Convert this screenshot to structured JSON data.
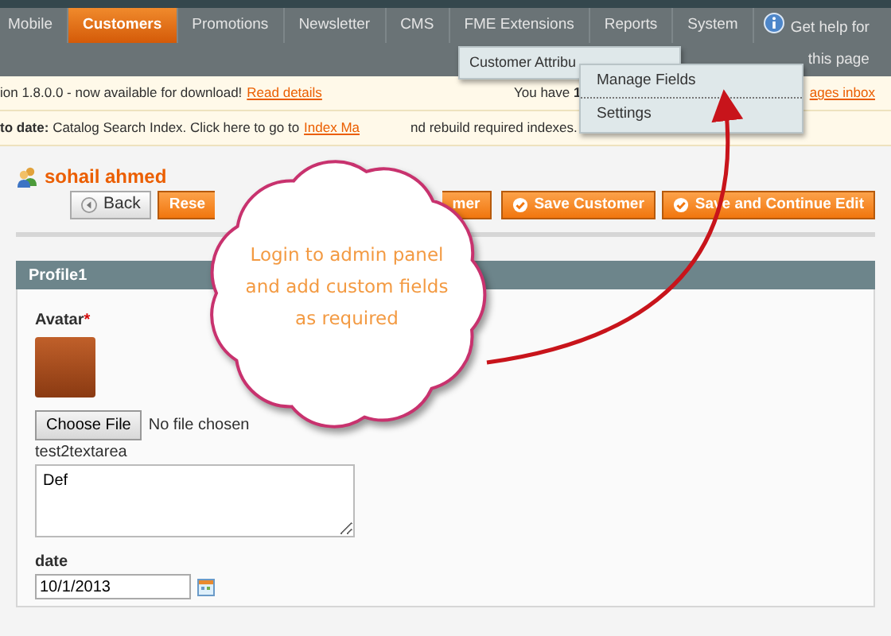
{
  "nav": {
    "items": [
      {
        "label": "Mobile",
        "selected": false
      },
      {
        "label": "Customers",
        "selected": true
      },
      {
        "label": "Promotions",
        "selected": false
      },
      {
        "label": "Newsletter",
        "selected": false
      },
      {
        "label": "CMS",
        "selected": false
      },
      {
        "label": "FME Extensions",
        "selected": false
      },
      {
        "label": "Reports",
        "selected": false
      },
      {
        "label": "System",
        "selected": false
      }
    ],
    "help": [
      "Get help for",
      "this page"
    ]
  },
  "dropdown": {
    "items": [
      "Customer Attribu"
    ],
    "submenu": [
      "Manage Fields",
      "Settings"
    ]
  },
  "notices": [
    {
      "text": "ion 1.8.0.0 - now available for download!",
      "link": "Read details",
      "right_text": "You have **1**",
      "right_link": "ages inbox"
    },
    {
      "text": "**to date:** Catalog Search Index. Click here to go to",
      "link": "Index Ma",
      "tail": "nd rebuild required indexes."
    }
  ],
  "customer": {
    "name": "sohail ahmed"
  },
  "buttons": [
    {
      "kind": "back",
      "label": "Back"
    },
    {
      "kind": "plain",
      "label": "Rese"
    },
    {
      "kind": "plain",
      "label": "mer"
    },
    {
      "kind": "check",
      "label": "Save Customer"
    },
    {
      "kind": "check",
      "label": "Save and Continue Edit"
    }
  ],
  "panel": {
    "title": "Profile1",
    "avatar_label": "Avatar",
    "required_mark": "*",
    "file_button": "Choose File",
    "file_status": "No file chosen",
    "textarea_label": "test2textarea",
    "textarea_value": "Def",
    "date_label": "date",
    "date_value": "10/1/2013"
  },
  "callout": {
    "lines": [
      "Login to admin panel",
      "and add custom fields",
      "as required"
    ]
  }
}
